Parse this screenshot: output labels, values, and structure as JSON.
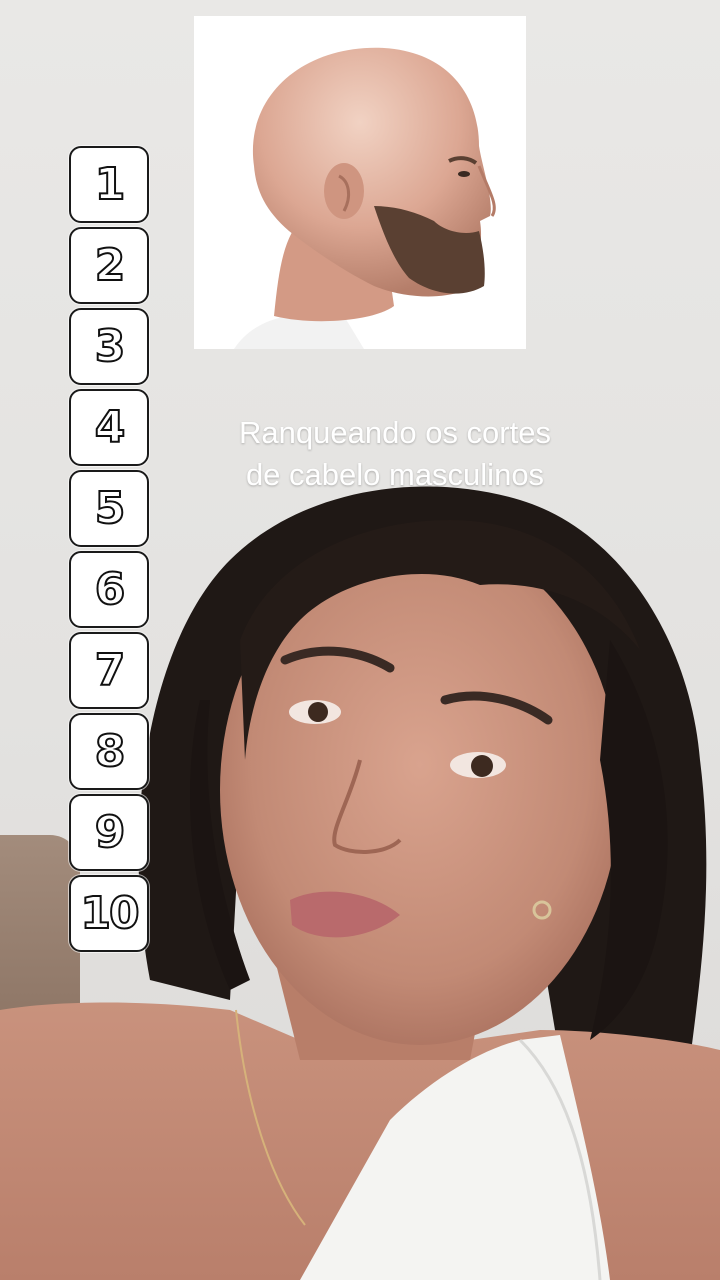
{
  "video": {
    "caption_line1": "Ranqueando os cortes",
    "caption_line2": "de cabelo masculinos"
  },
  "reference_image": {
    "subject": "bald-man-with-beard-profile"
  },
  "ranking": {
    "slots": [
      "1",
      "2",
      "3",
      "4",
      "5",
      "6",
      "7",
      "8",
      "9",
      "10"
    ]
  },
  "colors": {
    "wall": "#e4e3e1",
    "slot_border": "#1a1a1a",
    "caption": "#ffffff",
    "skin": "#c98f7a",
    "hair": "#1e1714"
  }
}
